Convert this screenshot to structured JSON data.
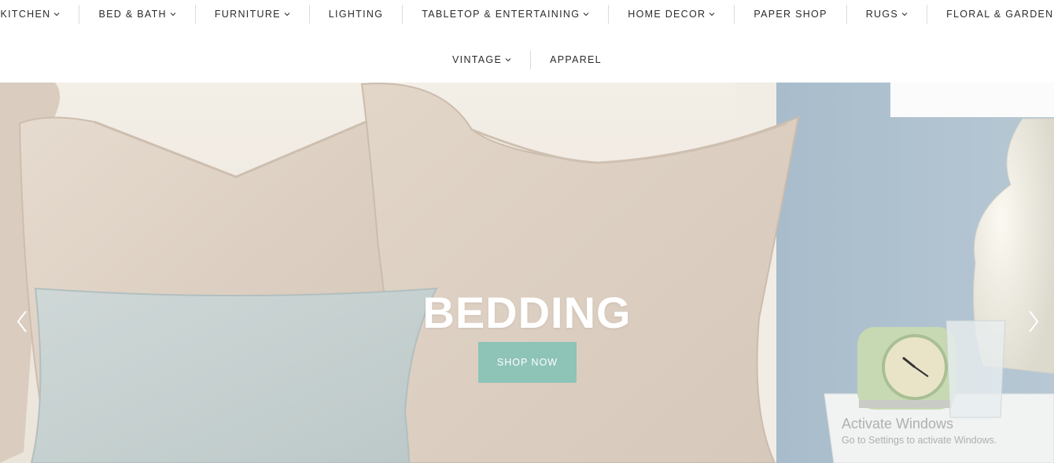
{
  "nav": {
    "row1": [
      {
        "label": "KITCHEN",
        "dropdown": true
      },
      {
        "label": "BED & BATH",
        "dropdown": true
      },
      {
        "label": "FURNITURE",
        "dropdown": true
      },
      {
        "label": "LIGHTING",
        "dropdown": false
      },
      {
        "label": "TABLETOP & ENTERTAINING",
        "dropdown": true
      },
      {
        "label": "HOME DECOR",
        "dropdown": true
      },
      {
        "label": "PAPER SHOP",
        "dropdown": false
      },
      {
        "label": "RUGS",
        "dropdown": true
      },
      {
        "label": "FLORAL & GARDEN",
        "dropdown": false
      }
    ],
    "row2": [
      {
        "label": "VINTAGE",
        "dropdown": true
      },
      {
        "label": "APPAREL",
        "dropdown": false
      }
    ]
  },
  "hero": {
    "title": "BEDDING",
    "button_label": "SHOP NOW",
    "prev_icon": "chevron-left-icon",
    "next_icon": "chevron-right-icon"
  },
  "watermark": {
    "title": "Activate Windows",
    "subtitle": "Go to Settings to activate Windows."
  },
  "colors": {
    "button_bg": "#8ec3b8",
    "nav_text": "#2b2b2b",
    "wall_blue": "#a9bccb",
    "linen": "#ddd0c3",
    "pillow_blue": "#c7d2d1"
  }
}
